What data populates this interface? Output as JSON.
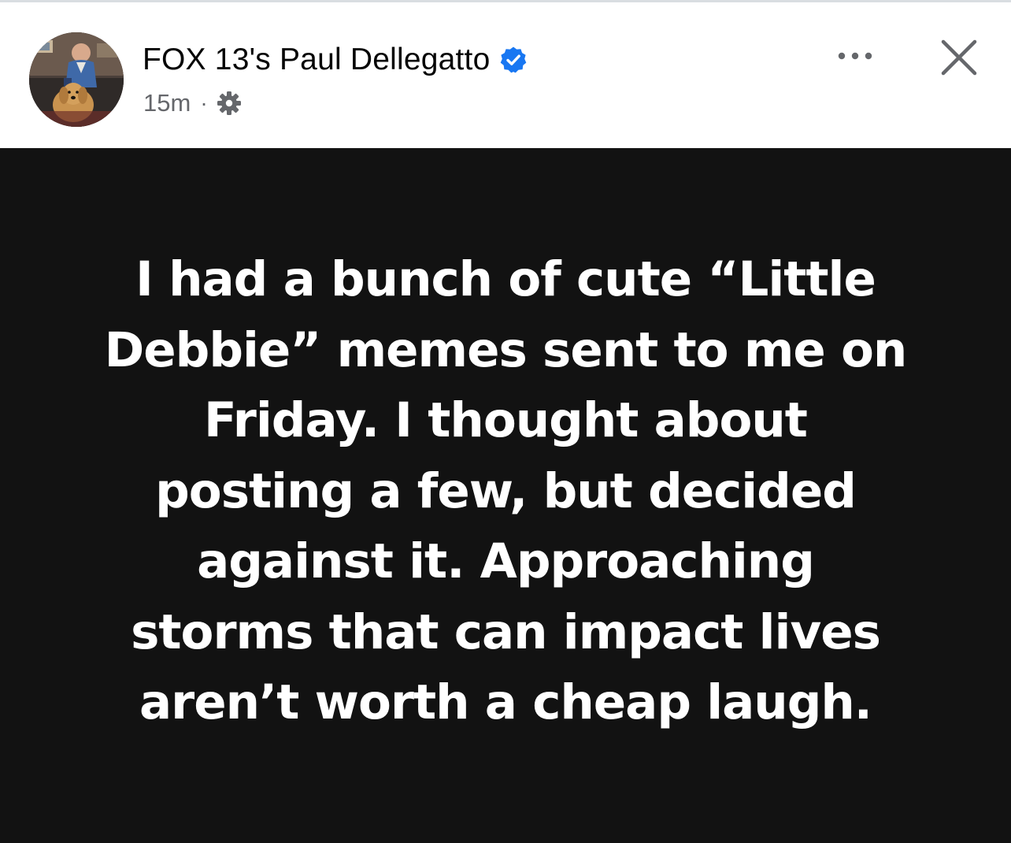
{
  "header": {
    "page_name": "FOX 13's Paul Dellegatto",
    "post_time": "15m",
    "separator": "·",
    "icons": {
      "verified": "verified-badge-icon",
      "audience": "settings-gear-icon",
      "more": "more-options-icon",
      "close": "close-icon"
    },
    "colors": {
      "verified_badge": "#1877f2",
      "name_text": "#050505",
      "meta_text": "#65676b"
    }
  },
  "post": {
    "background_color": "#121212",
    "text_color": "#ffffff",
    "text_lines": [
      "I had a bunch of cute “Little",
      "Debbie” memes sent to me on",
      "Friday. I thought about",
      "posting a few, but decided",
      "against it. Approaching",
      "storms that can impact lives",
      "aren’t worth a cheap laugh."
    ]
  }
}
